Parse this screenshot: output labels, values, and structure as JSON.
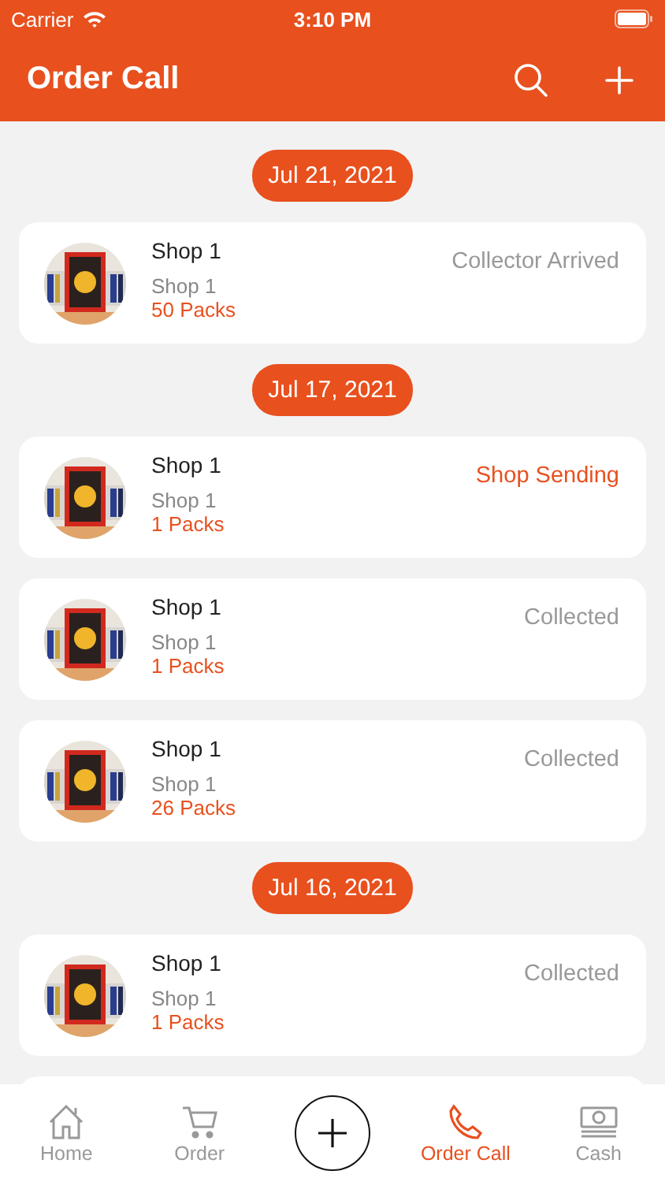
{
  "status_bar": {
    "carrier": "Carrier",
    "time": "3:10 PM"
  },
  "header": {
    "title": "Order Call"
  },
  "groups": [
    {
      "date": "Jul 21, 2021",
      "orders": [
        {
          "shop": "Shop 1",
          "subtitle": "Shop 1",
          "packs": "50 Packs",
          "status": "Collector Arrived",
          "highlighted": false
        }
      ]
    },
    {
      "date": "Jul 17, 2021",
      "orders": [
        {
          "shop": "Shop 1",
          "subtitle": "Shop 1",
          "packs": "1 Packs",
          "status": "Shop Sending",
          "highlighted": true
        },
        {
          "shop": "Shop 1",
          "subtitle": "Shop 1",
          "packs": "1 Packs",
          "status": "Collected",
          "highlighted": false
        },
        {
          "shop": "Shop 1",
          "subtitle": "Shop 1",
          "packs": "26 Packs",
          "status": "Collected",
          "highlighted": false
        }
      ]
    },
    {
      "date": "Jul 16, 2021",
      "orders": [
        {
          "shop": "Shop 1",
          "subtitle": "Shop 1",
          "packs": "1 Packs",
          "status": "Collected",
          "highlighted": false
        }
      ]
    }
  ],
  "tabs": [
    {
      "kind": "home",
      "label": "Home",
      "selected": false
    },
    {
      "kind": "order",
      "label": "Order",
      "selected": false
    },
    {
      "kind": "add"
    },
    {
      "kind": "call",
      "label": "Order Call",
      "selected": true
    },
    {
      "kind": "cash",
      "label": "Cash",
      "selected": false
    }
  ]
}
